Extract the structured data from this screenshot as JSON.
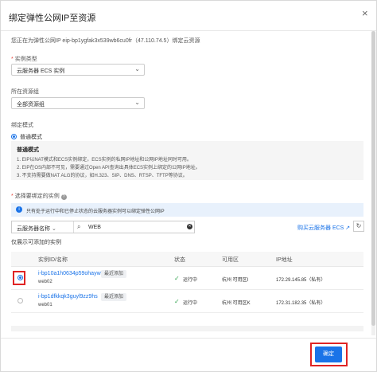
{
  "dialog": {
    "title": "绑定弹性公网IP至资源",
    "close_glyph": "×",
    "binding_text": "您正在为弹性公网IP eip-bp1ygfak3x539wb6cu0fr（47.110.74.5）绑定云资源"
  },
  "instance_type": {
    "label": "实例类型",
    "value": "云服务器 ECS 实例"
  },
  "resource_group": {
    "label": "所在资源组",
    "value": "全部资源组"
  },
  "binding_mode": {
    "label": "绑定模式",
    "option": "普通模式",
    "box_title": "普通模式",
    "notes": [
      "1. EIP以NAT模式和ECS实例绑定，ECS实例的私网IP地址和公网IP地址同时可用。",
      "2. EIP在OS内部不可见，需要通过Open API查询出具体ECS实例上绑定的公网IP地址。",
      "3. 不支持需要做NAT ALG的协议，如H.323、SIP、DNS、RTSP、TFTP等协议。"
    ]
  },
  "select_instance": {
    "label": "选择要绑定的实例",
    "help_glyph": "?",
    "info": "只有处于运行中和已停止状态的云服务器实例可以绑定弹性公网IP",
    "info_icon": "i",
    "filter_field": "云服务器名称",
    "search_value": "WEB",
    "clear_glyph": "✕",
    "buy_link": "购买云服务器 ECS",
    "external_glyph": "↗",
    "refresh_glyph": "↻",
    "show_bindable": "仅展示可添加的实例"
  },
  "table": {
    "headers": [
      "实例ID/名称",
      "状态",
      "可用区",
      "IP地址"
    ],
    "rows": [
      {
        "selected": true,
        "id": "i-bp10a1h0634p59ohayw5",
        "name": "web02",
        "tag": "最近添加",
        "status": "运行中",
        "zone": "杭州 可用区I",
        "ip": "172.29.145.85（私有）"
      },
      {
        "selected": false,
        "id": "i-bp1dfkkqk3guyl9zz9hs",
        "name": "web01",
        "tag": "最近添加",
        "status": "运行中",
        "zone": "杭州 可用区K",
        "ip": "172.31.182.35（私有）"
      }
    ]
  },
  "footer": {
    "confirm_label": "确定"
  },
  "colors": {
    "accent": "#1a73e8",
    "highlight": "#e02424",
    "success": "#3aa655"
  }
}
